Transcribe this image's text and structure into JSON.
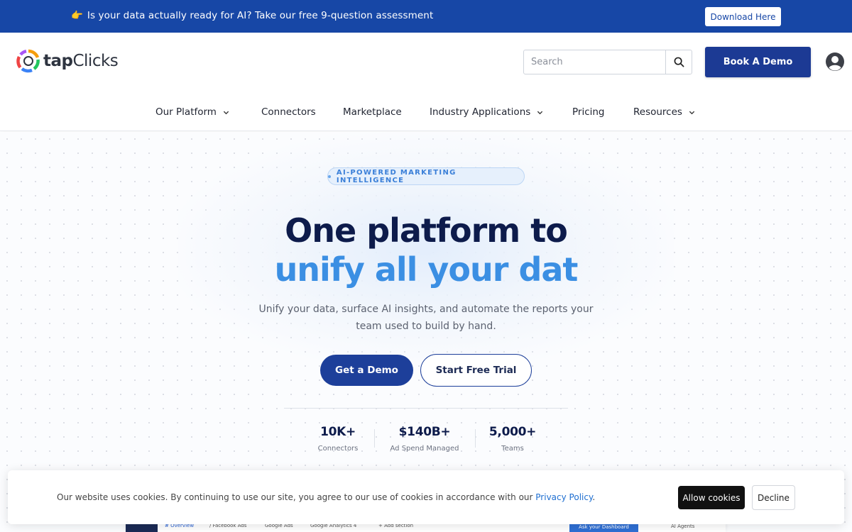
{
  "announcement": {
    "emoji": "👉",
    "text": "Is your data actually ready for AI? Take our free 9-question assessment",
    "button": "Download Here"
  },
  "header": {
    "logo_prefix": "tap",
    "logo_suffix": "Clicks",
    "search_placeholder": "Search",
    "cta": "Book A Demo",
    "icons": [
      "search-icon",
      "account-icon"
    ]
  },
  "nav": {
    "items": [
      {
        "label": "Our Platform",
        "dropdown": true
      },
      {
        "label": "Connectors",
        "dropdown": false
      },
      {
        "label": "Marketplace",
        "dropdown": false
      },
      {
        "label": "Industry Applications",
        "dropdown": true
      },
      {
        "label": "Pricing",
        "dropdown": false
      },
      {
        "label": "Resources",
        "dropdown": true
      }
    ]
  },
  "hero": {
    "pill": "AI-POWERED MARKETING INTELLIGENCE",
    "headline_line1": "One platform to",
    "headline_line2": "unify all your dat",
    "subheadline": "Unify your data, surface AI insights, and automate the reports your team used to build by hand.",
    "primary_cta": "Get a Demo",
    "secondary_cta": "Start Free Trial",
    "stats": [
      {
        "value": "10K+",
        "label": "Connectors"
      },
      {
        "value": "$140B+",
        "label": "Ad Spend Managed"
      },
      {
        "value": "5,000+",
        "label": "Teams"
      }
    ]
  },
  "preview": {
    "tabs": [
      "# Overview",
      "/ Facebook Ads",
      "Google Ads",
      "Google Analytics 4",
      "+ Add section"
    ],
    "ask_button": "Ask your Dashboard",
    "agents_label": "AI Agents"
  },
  "cookie": {
    "text": "Our website uses cookies. By continuing to use our site, you agree to our use of cookies in accordance with our",
    "link": "Privacy Policy",
    "period": ".",
    "allow": "Allow cookies",
    "decline": "Decline"
  },
  "colors": {
    "announcement_bg": "#1747a6",
    "primary": "#1d3f9a",
    "headline_dark": "#0d1b4b",
    "headline_accent": "#3b8fe3"
  }
}
